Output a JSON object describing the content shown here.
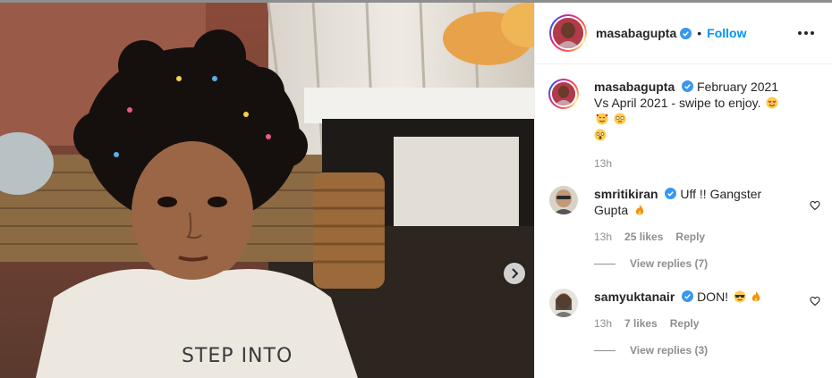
{
  "photo": {
    "shirt_text": "STEP INTO"
  },
  "post": {
    "owner": "masabagupta",
    "follow_label": "Follow",
    "caption": "February 2021 Vs April 2021 - swipe to enjoy.",
    "caption_emojis": [
      "heart-eyes-emoji",
      "smiling-hearts-emoji",
      "rolling-eyes-emoji",
      "shocked-emoji"
    ],
    "time": "13h"
  },
  "comments": [
    {
      "user": "smritikiran",
      "text": "Uff !! Gangster Gupta",
      "emojis": [
        "fire-emoji"
      ],
      "time": "13h",
      "likes": "25 likes",
      "reply_label": "Reply",
      "view_replies": "View replies (7)"
    },
    {
      "user": "samyuktanair",
      "text": "DON!",
      "emojis": [
        "sunglasses-emoji",
        "fire-emoji"
      ],
      "time": "13h",
      "likes": "7 likes",
      "reply_label": "Reply",
      "view_replies": "View replies (3)"
    }
  ],
  "colors": {
    "link": "#0095f6",
    "muted": "#8e8e8e",
    "text": "#262626"
  }
}
